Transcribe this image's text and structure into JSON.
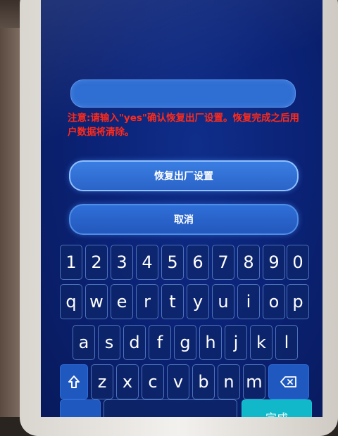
{
  "reset_dialog": {
    "confirm_input": {
      "value": "",
      "placeholder": ""
    },
    "warning_text": "注意:请输入\"yes\"确认恢复出厂设置。恢复完成之后用户数据将清除。",
    "reset_button_label": "恢复出厂设置",
    "cancel_button_label": "取消"
  },
  "keyboard": {
    "number_row": [
      "1",
      "2",
      "3",
      "4",
      "5",
      "6",
      "7",
      "8",
      "9",
      "0"
    ],
    "row1": [
      "q",
      "w",
      "e",
      "r",
      "t",
      "y",
      "u",
      "i",
      "o",
      "p"
    ],
    "row2": [
      "a",
      "s",
      "d",
      "f",
      "g",
      "h",
      "j",
      "k",
      "l"
    ],
    "row3": [
      "z",
      "x",
      "c",
      "v",
      "b",
      "n",
      "m"
    ],
    "shift_icon": "shift-arrow-icon",
    "backspace_icon": "backspace-icon",
    "done_label": "完成"
  },
  "colors": {
    "screen_background": "#0b2377",
    "warning_text": "#ff2a1a",
    "button_fill": "#3a7ee3",
    "key_border": "#4c73b9",
    "done_key": "#11b8c9"
  }
}
